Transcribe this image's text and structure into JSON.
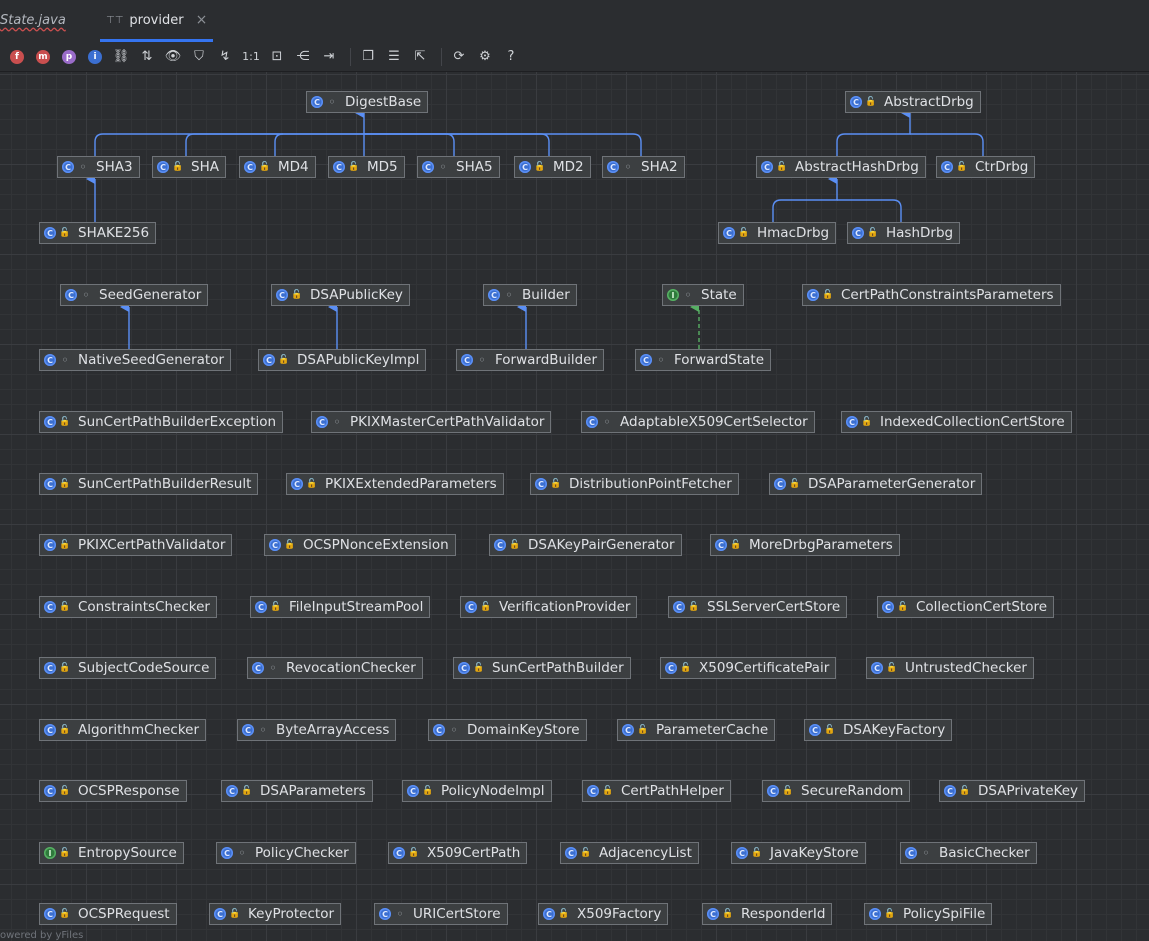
{
  "tabs": [
    {
      "label": "State.java",
      "active": false
    },
    {
      "label": "provider",
      "active": true
    }
  ],
  "toolbar": {
    "zoom_actual_label": "1:1",
    "help_label": "?",
    "icons": [
      "show-fields-icon",
      "show-methods-icon",
      "show-properties-icon",
      "show-inner-classes-icon",
      "show-dependencies-icon",
      "sort-icon",
      "visibility-icon",
      "filter-icon",
      "edge-mode-icon",
      "actual-size-icon",
      "fit-content-icon",
      "layout-icon",
      "route-edges-icon",
      "copy-diagram-icon",
      "apply-layout-icon",
      "export-icon",
      "refresh-icon",
      "settings-icon",
      "help-icon"
    ]
  },
  "colors": {
    "background": "#2b2d30",
    "node_fill": "#3c3f41",
    "edge_blue": "#5b8ff5",
    "edge_green": "#57b064"
  },
  "nodes": [
    {
      "id": "DigestBase",
      "label": "DigestBase",
      "kind": "class",
      "access": "pkg"
    },
    {
      "id": "AbstractDrbg",
      "label": "AbstractDrbg",
      "kind": "class",
      "access": "pub"
    },
    {
      "id": "SHA3",
      "label": "SHA3",
      "kind": "class",
      "access": "pkg"
    },
    {
      "id": "SHA",
      "label": "SHA",
      "kind": "class",
      "access": "pub"
    },
    {
      "id": "MD4",
      "label": "MD4",
      "kind": "class",
      "access": "pub"
    },
    {
      "id": "MD5",
      "label": "MD5",
      "kind": "class",
      "access": "pub"
    },
    {
      "id": "SHA5",
      "label": "SHA5",
      "kind": "class",
      "access": "pkg"
    },
    {
      "id": "MD2",
      "label": "MD2",
      "kind": "class",
      "access": "pub"
    },
    {
      "id": "SHA2",
      "label": "SHA2",
      "kind": "class",
      "access": "pkg"
    },
    {
      "id": "AbstractHashDrbg",
      "label": "AbstractHashDrbg",
      "kind": "class",
      "access": "pub"
    },
    {
      "id": "CtrDrbg",
      "label": "CtrDrbg",
      "kind": "class",
      "access": "pub"
    },
    {
      "id": "SHAKE256",
      "label": "SHAKE256",
      "kind": "class",
      "access": "pub"
    },
    {
      "id": "HmacDrbg",
      "label": "HmacDrbg",
      "kind": "class",
      "access": "pub"
    },
    {
      "id": "HashDrbg",
      "label": "HashDrbg",
      "kind": "class",
      "access": "pub"
    },
    {
      "id": "SeedGenerator",
      "label": "SeedGenerator",
      "kind": "class",
      "access": "pkg"
    },
    {
      "id": "DSAPublicKey",
      "label": "DSAPublicKey",
      "kind": "class",
      "access": "pub"
    },
    {
      "id": "Builder",
      "label": "Builder",
      "kind": "class",
      "access": "pkg"
    },
    {
      "id": "State",
      "label": "State",
      "kind": "interface",
      "access": "pkg"
    },
    {
      "id": "CertPathConstraintsParameters",
      "label": "CertPathConstraintsParameters",
      "kind": "class",
      "access": "pub"
    },
    {
      "id": "NativeSeedGenerator",
      "label": "NativeSeedGenerator",
      "kind": "class",
      "access": "pkg"
    },
    {
      "id": "DSAPublicKeyImpl",
      "label": "DSAPublicKeyImpl",
      "kind": "class",
      "access": "pub"
    },
    {
      "id": "ForwardBuilder",
      "label": "ForwardBuilder",
      "kind": "class",
      "access": "pkg"
    },
    {
      "id": "ForwardState",
      "label": "ForwardState",
      "kind": "class",
      "access": "pkg"
    },
    {
      "id": "SunCertPathBuilderException",
      "label": "SunCertPathBuilderException",
      "kind": "class",
      "access": "pub"
    },
    {
      "id": "PKIXMasterCertPathValidator",
      "label": "PKIXMasterCertPathValidator",
      "kind": "class",
      "access": "pkg"
    },
    {
      "id": "AdaptableX509CertSelector",
      "label": "AdaptableX509CertSelector",
      "kind": "class",
      "access": "pkg"
    },
    {
      "id": "IndexedCollectionCertStore",
      "label": "IndexedCollectionCertStore",
      "kind": "class",
      "access": "pub"
    },
    {
      "id": "SunCertPathBuilderResult",
      "label": "SunCertPathBuilderResult",
      "kind": "class",
      "access": "pub"
    },
    {
      "id": "PKIXExtendedParameters",
      "label": "PKIXExtendedParameters",
      "kind": "class",
      "access": "pub"
    },
    {
      "id": "DistributionPointFetcher",
      "label": "DistributionPointFetcher",
      "kind": "class",
      "access": "pub"
    },
    {
      "id": "DSAParameterGenerator",
      "label": "DSAParameterGenerator",
      "kind": "class",
      "access": "pub"
    },
    {
      "id": "PKIXCertPathValidator",
      "label": "PKIXCertPathValidator",
      "kind": "class",
      "access": "pub"
    },
    {
      "id": "OCSPNonceExtension",
      "label": "OCSPNonceExtension",
      "kind": "class",
      "access": "pub"
    },
    {
      "id": "DSAKeyPairGenerator",
      "label": "DSAKeyPairGenerator",
      "kind": "class",
      "access": "pub"
    },
    {
      "id": "MoreDrbgParameters",
      "label": "MoreDrbgParameters",
      "kind": "class",
      "access": "pub"
    },
    {
      "id": "ConstraintsChecker",
      "label": "ConstraintsChecker",
      "kind": "class",
      "access": "pub"
    },
    {
      "id": "FileInputStreamPool",
      "label": "FileInputStreamPool",
      "kind": "class",
      "access": "pub"
    },
    {
      "id": "VerificationProvider",
      "label": "VerificationProvider",
      "kind": "class",
      "access": "pub"
    },
    {
      "id": "SSLServerCertStore",
      "label": "SSLServerCertStore",
      "kind": "class",
      "access": "pub"
    },
    {
      "id": "CollectionCertStore",
      "label": "CollectionCertStore",
      "kind": "class",
      "access": "pub"
    },
    {
      "id": "SubjectCodeSource",
      "label": "SubjectCodeSource",
      "kind": "class",
      "access": "pub"
    },
    {
      "id": "RevocationChecker",
      "label": "RevocationChecker",
      "kind": "class",
      "access": "pkg"
    },
    {
      "id": "SunCertPathBuilder",
      "label": "SunCertPathBuilder",
      "kind": "class",
      "access": "pub"
    },
    {
      "id": "X509CertificatePair",
      "label": "X509CertificatePair",
      "kind": "class",
      "access": "pub"
    },
    {
      "id": "UntrustedChecker",
      "label": "UntrustedChecker",
      "kind": "class",
      "access": "pub"
    },
    {
      "id": "AlgorithmChecker",
      "label": "AlgorithmChecker",
      "kind": "class",
      "access": "pub"
    },
    {
      "id": "ByteArrayAccess",
      "label": "ByteArrayAccess",
      "kind": "class",
      "access": "pkg"
    },
    {
      "id": "DomainKeyStore",
      "label": "DomainKeyStore",
      "kind": "class",
      "access": "pkg"
    },
    {
      "id": "ParameterCache",
      "label": "ParameterCache",
      "kind": "class",
      "access": "pub"
    },
    {
      "id": "DSAKeyFactory",
      "label": "DSAKeyFactory",
      "kind": "class",
      "access": "pub"
    },
    {
      "id": "OCSPResponse",
      "label": "OCSPResponse",
      "kind": "class",
      "access": "pub"
    },
    {
      "id": "DSAParameters",
      "label": "DSAParameters",
      "kind": "class",
      "access": "pub"
    },
    {
      "id": "PolicyNodeImpl",
      "label": "PolicyNodeImpl",
      "kind": "class",
      "access": "pub"
    },
    {
      "id": "CertPathHelper",
      "label": "CertPathHelper",
      "kind": "class",
      "access": "pub"
    },
    {
      "id": "SecureRandom",
      "label": "SecureRandom",
      "kind": "class",
      "access": "pub"
    },
    {
      "id": "DSAPrivateKey",
      "label": "DSAPrivateKey",
      "kind": "class",
      "access": "pub"
    },
    {
      "id": "EntropySource",
      "label": "EntropySource",
      "kind": "interface",
      "access": "pub"
    },
    {
      "id": "PolicyChecker",
      "label": "PolicyChecker",
      "kind": "class",
      "access": "pkg"
    },
    {
      "id": "X509CertPath",
      "label": "X509CertPath",
      "kind": "class",
      "access": "pub"
    },
    {
      "id": "AdjacencyList",
      "label": "AdjacencyList",
      "kind": "class",
      "access": "pub"
    },
    {
      "id": "JavaKeyStore",
      "label": "JavaKeyStore",
      "kind": "class",
      "access": "pub"
    },
    {
      "id": "BasicChecker",
      "label": "BasicChecker",
      "kind": "class",
      "access": "pkg"
    },
    {
      "id": "OCSPRequest",
      "label": "OCSPRequest",
      "kind": "class",
      "access": "pub"
    },
    {
      "id": "KeyProtector",
      "label": "KeyProtector",
      "kind": "class",
      "access": "pub"
    },
    {
      "id": "URICertStore",
      "label": "URICertStore",
      "kind": "class",
      "access": "pkg"
    },
    {
      "id": "X509Factory",
      "label": "X509Factory",
      "kind": "class",
      "access": "pub"
    },
    {
      "id": "ResponderId",
      "label": "ResponderId",
      "kind": "class",
      "access": "pub"
    },
    {
      "id": "PolicySpiFile",
      "label": "PolicySpiFile",
      "kind": "class",
      "access": "pub"
    }
  ],
  "edges": [
    {
      "from": "SHA3",
      "to": "DigestBase",
      "type": "extends"
    },
    {
      "from": "SHA",
      "to": "DigestBase",
      "type": "extends"
    },
    {
      "from": "MD4",
      "to": "DigestBase",
      "type": "extends"
    },
    {
      "from": "MD5",
      "to": "DigestBase",
      "type": "extends"
    },
    {
      "from": "SHA5",
      "to": "DigestBase",
      "type": "extends"
    },
    {
      "from": "MD2",
      "to": "DigestBase",
      "type": "extends"
    },
    {
      "from": "SHA2",
      "to": "DigestBase",
      "type": "extends"
    },
    {
      "from": "SHAKE256",
      "to": "SHA3",
      "type": "extends"
    },
    {
      "from": "AbstractHashDrbg",
      "to": "AbstractDrbg",
      "type": "extends"
    },
    {
      "from": "CtrDrbg",
      "to": "AbstractDrbg",
      "type": "extends"
    },
    {
      "from": "HmacDrbg",
      "to": "AbstractHashDrbg",
      "type": "extends"
    },
    {
      "from": "HashDrbg",
      "to": "AbstractHashDrbg",
      "type": "extends"
    },
    {
      "from": "NativeSeedGenerator",
      "to": "SeedGenerator",
      "type": "extends"
    },
    {
      "from": "DSAPublicKeyImpl",
      "to": "DSAPublicKey",
      "type": "extends"
    },
    {
      "from": "ForwardBuilder",
      "to": "Builder",
      "type": "extends"
    },
    {
      "from": "ForwardState",
      "to": "State",
      "type": "implements"
    }
  ],
  "footer": {
    "text": "owered by yFiles"
  }
}
